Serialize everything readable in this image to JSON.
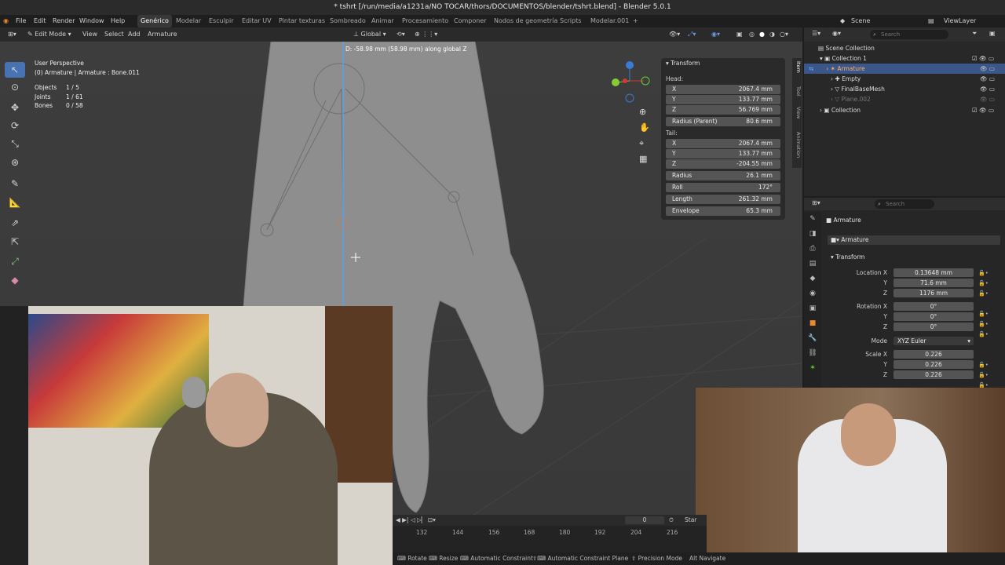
{
  "window": {
    "title": "* tshrt [/run/media/a1231a/NO TOCAR/thors/DOCUMENTOS/blender/tshrt.blend] - Blender 5.0.1"
  },
  "menu": [
    "File",
    "Edit",
    "Render",
    "Window",
    "Help"
  ],
  "workspaces": [
    "Genérico",
    "Modelar",
    "Esculpir",
    "Editar UV",
    "Pintar texturas",
    "Sombreado",
    "Animar",
    "Procesamiento",
    "Componer",
    "Nodos de geometría",
    "Scripts",
    "Modelar.001"
  ],
  "topright": {
    "scene": "Scene",
    "view_layer": "ViewLayer"
  },
  "viewport_header": {
    "mode": "Edit Mode",
    "view": "View",
    "select": "Select",
    "add": "Add",
    "armature": "Armature",
    "orientation": "Global"
  },
  "operator_hint": "D: -58.98 mm (58.98 mm) along global Z",
  "viewport_info": {
    "perspective": "User Perspective",
    "object": "(0) Armature | Armature : Bone.011",
    "stats": [
      {
        "label": "Objects",
        "value": "1 / 5"
      },
      {
        "label": "Joints",
        "value": "1 / 61"
      },
      {
        "label": "Bones",
        "value": "0 / 58"
      }
    ]
  },
  "transform_panel": {
    "title": "Transform",
    "head_label": "Head:",
    "head": [
      {
        "k": "X",
        "v": "2067.4 mm"
      },
      {
        "k": "Y",
        "v": "133.77 mm"
      },
      {
        "k": "Z",
        "v": "56.769 mm"
      }
    ],
    "radius_parent": {
      "k": "Radius (Parent)",
      "v": "80.6 mm"
    },
    "tail_label": "Tail:",
    "tail": [
      {
        "k": "X",
        "v": "2067.4 mm"
      },
      {
        "k": "Y",
        "v": "133.77 mm"
      },
      {
        "k": "Z",
        "v": "-204.55 mm"
      }
    ],
    "extra": [
      {
        "k": "Radius",
        "v": "26.1 mm"
      },
      {
        "k": "Roll",
        "v": "172°"
      },
      {
        "k": "Length",
        "v": "261.32 mm"
      },
      {
        "k": "Envelope",
        "v": "65.3 mm"
      }
    ]
  },
  "side_tabs": [
    "Item",
    "Tool",
    "View",
    "Animation"
  ],
  "outliner": {
    "search_placeholder": "Search",
    "items": [
      "Scene Collection",
      "Collection 1",
      "Armature",
      "Empty",
      "FinalBaseMesh",
      "Plane.002",
      "Collection"
    ]
  },
  "properties": {
    "search_placeholder": "Search",
    "object_name": "Armature",
    "data_name": "Armature",
    "section": "Transform",
    "location_label": "Location X",
    "location": [
      "0.13648 mm",
      "71.6 mm",
      "1176 mm"
    ],
    "rotation_label": "Rotation X",
    "rotation": [
      "0°",
      "0°",
      "0°"
    ],
    "mode_label": "Mode",
    "mode": "XYZ Euler",
    "scale_label": "Scale X",
    "scale": [
      "0.226",
      "0.226",
      "0.226"
    ],
    "axis_y": "Y",
    "axis_z": "Z"
  },
  "timeline": {
    "current_frame": "0",
    "start_label": "Star",
    "ticks": [
      "132",
      "144",
      "156",
      "168",
      "180",
      "192",
      "204",
      "216"
    ]
  },
  "statusbar": [
    "Rotate",
    "Resize",
    "Automatic Constraint",
    "Automatic Constraint Plane",
    "Precision Mode",
    "Navigate"
  ],
  "colors": {
    "accent": "#4772b3",
    "selected_text": "#ffb067",
    "bone_line": "#5aa0e6"
  }
}
